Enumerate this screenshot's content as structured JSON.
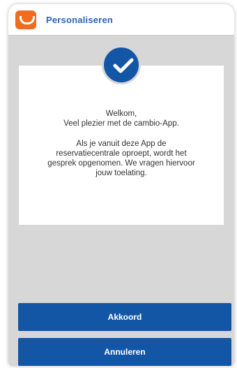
{
  "header": {
    "title": "Personaliseren",
    "logo_icon": "cambio-logo-icon"
  },
  "status_icon": "checkmark-circle-icon",
  "message": {
    "greeting": "Welkom,",
    "intro": "Veel plezier met de cambio-App.",
    "body_lines": [
      "Als je vanuit deze App de",
      "reservatiecentrale oproept, wordt het",
      "gesprek opgenomen. We vragen hiervoor",
      "jouw toelating."
    ]
  },
  "buttons": {
    "accept_label": "Akkoord",
    "cancel_label": "Annuleren"
  },
  "colors": {
    "brand_orange": "#f06c1e",
    "primary_blue": "#1456a6",
    "title_blue": "#2a66b3",
    "background_gray": "#d7d7d7"
  }
}
